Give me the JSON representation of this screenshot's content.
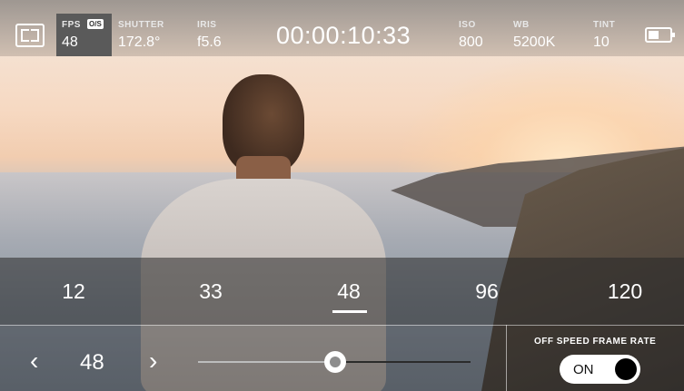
{
  "status_bar": {
    "fps": {
      "label": "FPS",
      "badge": "O/S",
      "value": "48"
    },
    "shutter": {
      "label": "SHUTTER",
      "value": "172.8°"
    },
    "iris": {
      "label": "IRIS",
      "value": "f5.6"
    },
    "timecode": "00:00:10:33",
    "iso": {
      "label": "ISO",
      "value": "800"
    },
    "wb": {
      "label": "WB",
      "value": "5200K"
    },
    "tint": {
      "label": "TINT",
      "value": "10"
    },
    "battery_icon": "battery-icon"
  },
  "frame_rate_presets": [
    "12",
    "33",
    "48",
    "96",
    "120"
  ],
  "selected_preset": "48",
  "frame_rate_control": {
    "prev_icon": "chevron-left-icon",
    "value": "48",
    "next_icon": "chevron-right-icon"
  },
  "off_speed": {
    "label": "OFF SPEED FRAME RATE",
    "toggle_label": "ON",
    "enabled": true
  },
  "colors": {
    "selected_tab_bg": "#5a5a5a",
    "overlay": "#282828"
  }
}
